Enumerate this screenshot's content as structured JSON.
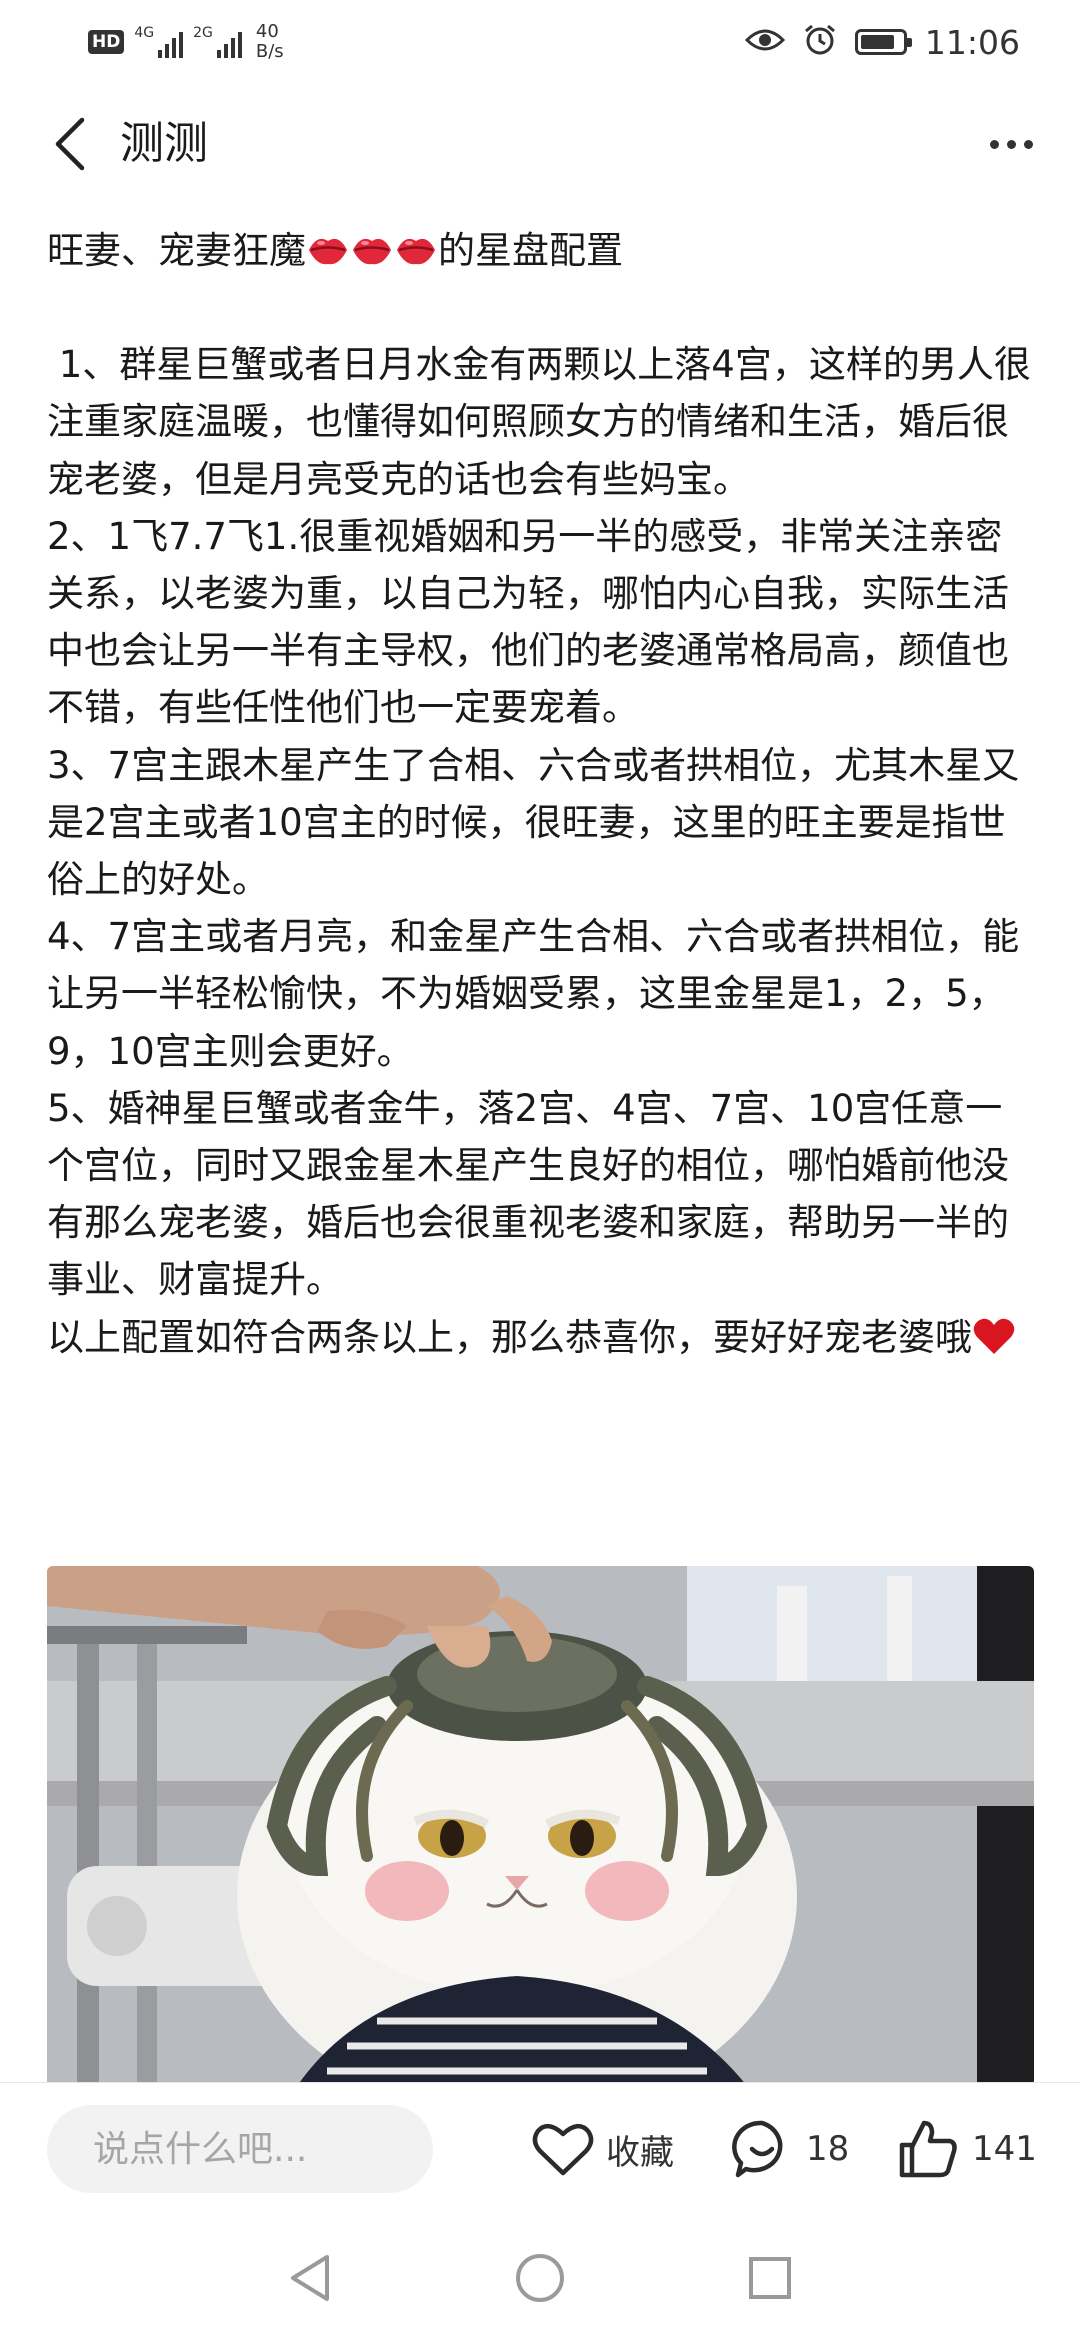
{
  "status_bar": {
    "hd": "HD",
    "sim1_net": "4G",
    "sim2_net": "2G",
    "speed_value": "40",
    "speed_unit": "B/s",
    "time": "11:06"
  },
  "nav": {
    "title": "测测"
  },
  "article": {
    "headline_before": "旺妻、宠妻狂魔",
    "headline_after": "的星盘配置",
    "p1": " 1、群星巨蟹或者日月水金有两颗以上落4宫，这样的男人很注重家庭温暖，也懂得如何照顾女方的情绪和生活，婚后很宠老婆，但是月亮受克的话也会有些妈宝。",
    "p2": "2、1飞7.7飞1.很重视婚姻和另一半的感受，非常关注亲密关系，以老婆为重，以自己为轻，哪怕内心自我，实际生活中也会让另一半有主导权，他们的老婆通常格局高，颜值也不错，有些任性他们也一定要宠着。",
    "p3": "3、7宫主跟木星产生了合相、六合或者拱相位，尤其木星又是2宫主或者10宫主的时候，很旺妻，这里的旺主要是指世俗上的好处。",
    "p4": "4、7宫主或者月亮，和金星产生合相、六合或者拱相位，能让另一半轻松愉快，不为婚姻受累，这里金星是1，2，5，9，10宫主则会更好。",
    "p5": "5、婚神星巨蟹或者金牛，落2宫、4宫、7宫、10宫任意一个宫位，同时又跟金星木星产生良好的相位，哪怕婚前他没有那么宠老婆，婚后也会很重视老婆和家庭，帮助另一半的事业、财富提升。",
    "p6": "以上配置如符合两条以上，那么恭喜你，要好好宠老婆哦"
  },
  "bottom_bar": {
    "comment_placeholder": "说点什么吧...",
    "favorite_label": "收藏",
    "comment_count": "18",
    "like_count": "141"
  },
  "colors": {
    "text": "#1a1a1a",
    "icon": "#333333",
    "input_bg": "#f2f2f2",
    "lips": "#e0283a",
    "heart": "#d9151f"
  }
}
